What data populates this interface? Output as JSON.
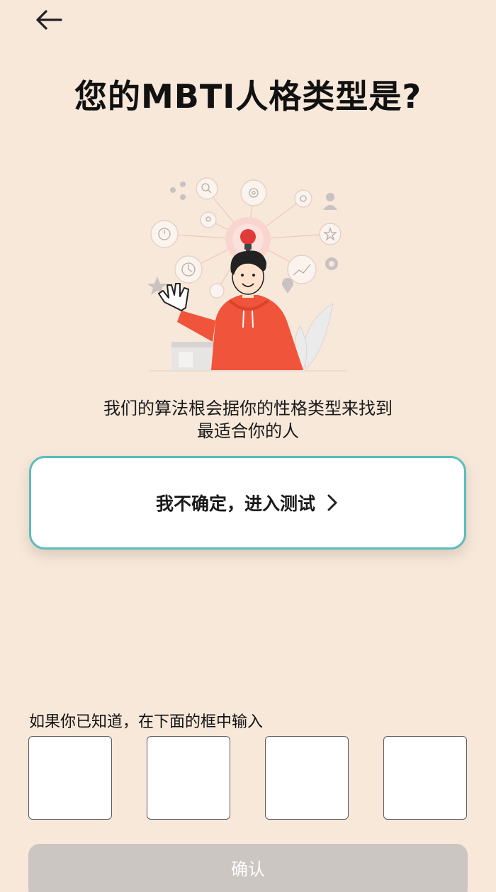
{
  "header": {
    "back_icon": "arrow-left-icon",
    "title": "您的MBTI人格类型是?"
  },
  "illustration": {
    "description_icon": "idea-person-icon",
    "colors": {
      "shirt": "#f0543a",
      "bulb": "#e03b3b",
      "line": "#e8b8ac"
    }
  },
  "intro": {
    "line1": "我们的算法根会据你的性格类型来找到",
    "line2": "最适合你的人"
  },
  "test_card": {
    "label": "我不确定，进入测试",
    "icon": "chevron-right-icon",
    "border_color": "#5bbcbc"
  },
  "manual_entry": {
    "hint": "如果你已知道，在下面的框中输入",
    "boxes": [
      "",
      "",
      "",
      ""
    ]
  },
  "confirm": {
    "label": "确认"
  }
}
